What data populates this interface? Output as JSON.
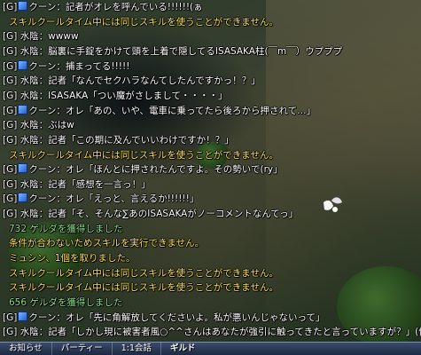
{
  "chat": {
    "lines": [
      {
        "type": "guild",
        "channel": "[G]",
        "name": "クーン",
        "emblem": true,
        "text": "：記者がオレを呼んでいる!!!!!!(ぁ"
      },
      {
        "type": "system",
        "text": "スキルクールタイム中には同じスキルを使うことができません。"
      },
      {
        "type": "guild",
        "channel": "[G]",
        "name": "水陰",
        "emblem": false,
        "text": "：wwww"
      },
      {
        "type": "guild",
        "channel": "[G]",
        "name": "水陰",
        "emblem": false,
        "text": "：脳裏に手錠をかけて頭を上着で隠してるISASAKA柱(￣m￣）ウプププ"
      },
      {
        "type": "guild",
        "channel": "[G]",
        "name": "クーン",
        "emblem": true,
        "text": "：捕まってる!!!!!"
      },
      {
        "type": "guild",
        "channel": "[G]",
        "name": "水陰",
        "emblem": false,
        "text": "：記者「なんでセクハラなんてしたんですかっ！？」"
      },
      {
        "type": "guild",
        "channel": "[G]",
        "name": "水陰",
        "emblem": false,
        "text": "：ISASAKA「つい魔がさしまして・・・・」"
      },
      {
        "type": "guild",
        "channel": "[G]",
        "name": "クーン",
        "emblem": true,
        "text": "：オレ「あの、いや、電車に乗ってたら後ろから押されて…」"
      },
      {
        "type": "guild",
        "channel": "[G]",
        "name": "水陰",
        "emblem": false,
        "text": "：ぶはw"
      },
      {
        "type": "guild",
        "channel": "[G]",
        "name": "水陰",
        "emblem": false,
        "text": "：記者「この期に及んでいいわけですか！？」"
      },
      {
        "type": "system",
        "text": "スキルクールタイム中には同じスキルを使うことができません。"
      },
      {
        "type": "guild",
        "channel": "[G]",
        "name": "クーン",
        "emblem": true,
        "text": "：オレ「ほんとに押されたんですよ。その勢いで(ry」"
      },
      {
        "type": "guild",
        "channel": "[G]",
        "name": "水陰",
        "emblem": false,
        "text": "：記者「感想を一言っ！」"
      },
      {
        "type": "guild",
        "channel": "[G]",
        "name": "クーン",
        "emblem": true,
        "text": "：オレ「えっと、言えるか!!!!!!」"
      },
      {
        "type": "guild",
        "channel": "[G]",
        "name": "水陰",
        "emblem": false,
        "text": "：記者「そ、そんな∑あのISASAKAがノーコメントなんてっ」"
      },
      {
        "type": "gain",
        "text": "732 ゲルダを獲得しました"
      },
      {
        "type": "system",
        "text": "条件が合わないためスキルを実行できません。"
      },
      {
        "type": "system",
        "text": "ミュシン、1個を取りました。"
      },
      {
        "type": "system",
        "text": "スキルクールタイム中には同じスキルを使うことができません。"
      },
      {
        "type": "system",
        "text": "スキルクールタイム中には同じスキルを使うことができません。"
      },
      {
        "type": "gain",
        "text": "656 ゲルダを獲得しました"
      },
      {
        "type": "guild",
        "channel": "[G]",
        "name": "クーン",
        "emblem": true,
        "text": "：オレ「先に角解放してくださいよ。私が悪いんじゃないって」"
      },
      {
        "type": "guild",
        "channel": "[G]",
        "name": "水陰",
        "emblem": false,
        "text": "：記者「しかし現に被害者風○^^さんはあなたが強引に触ってきたと言っていますが？」(何"
      }
    ]
  },
  "tabs": [
    {
      "label": "お知らせ",
      "active": false
    },
    {
      "label": "パーティー",
      "active": false
    },
    {
      "label": "1:1会話",
      "active": false
    },
    {
      "label": "ギルド",
      "active": true
    }
  ],
  "colors": {
    "guild_text": "#ffffff",
    "system_text": "#ffe65a",
    "gain_text": "#8fe08a",
    "guild_emblem": "#1f5fd8"
  }
}
